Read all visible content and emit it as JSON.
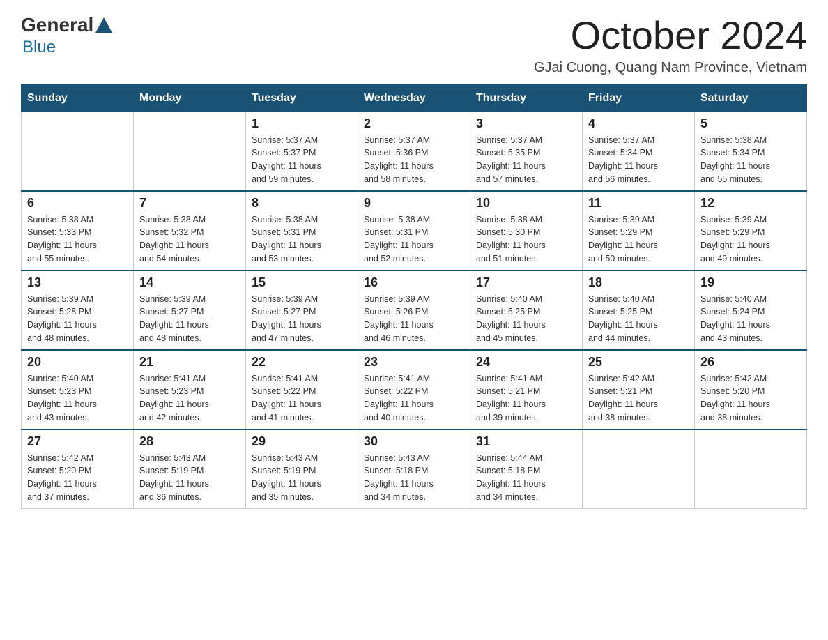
{
  "logo": {
    "general": "General",
    "blue": "Blue"
  },
  "title": "October 2024",
  "subtitle": "GJai Cuong, Quang Nam Province, Vietnam",
  "days_of_week": [
    "Sunday",
    "Monday",
    "Tuesday",
    "Wednesday",
    "Thursday",
    "Friday",
    "Saturday"
  ],
  "weeks": [
    [
      {
        "day": "",
        "info": ""
      },
      {
        "day": "",
        "info": ""
      },
      {
        "day": "1",
        "info": "Sunrise: 5:37 AM\nSunset: 5:37 PM\nDaylight: 11 hours\nand 59 minutes."
      },
      {
        "day": "2",
        "info": "Sunrise: 5:37 AM\nSunset: 5:36 PM\nDaylight: 11 hours\nand 58 minutes."
      },
      {
        "day": "3",
        "info": "Sunrise: 5:37 AM\nSunset: 5:35 PM\nDaylight: 11 hours\nand 57 minutes."
      },
      {
        "day": "4",
        "info": "Sunrise: 5:37 AM\nSunset: 5:34 PM\nDaylight: 11 hours\nand 56 minutes."
      },
      {
        "day": "5",
        "info": "Sunrise: 5:38 AM\nSunset: 5:34 PM\nDaylight: 11 hours\nand 55 minutes."
      }
    ],
    [
      {
        "day": "6",
        "info": "Sunrise: 5:38 AM\nSunset: 5:33 PM\nDaylight: 11 hours\nand 55 minutes."
      },
      {
        "day": "7",
        "info": "Sunrise: 5:38 AM\nSunset: 5:32 PM\nDaylight: 11 hours\nand 54 minutes."
      },
      {
        "day": "8",
        "info": "Sunrise: 5:38 AM\nSunset: 5:31 PM\nDaylight: 11 hours\nand 53 minutes."
      },
      {
        "day": "9",
        "info": "Sunrise: 5:38 AM\nSunset: 5:31 PM\nDaylight: 11 hours\nand 52 minutes."
      },
      {
        "day": "10",
        "info": "Sunrise: 5:38 AM\nSunset: 5:30 PM\nDaylight: 11 hours\nand 51 minutes."
      },
      {
        "day": "11",
        "info": "Sunrise: 5:39 AM\nSunset: 5:29 PM\nDaylight: 11 hours\nand 50 minutes."
      },
      {
        "day": "12",
        "info": "Sunrise: 5:39 AM\nSunset: 5:29 PM\nDaylight: 11 hours\nand 49 minutes."
      }
    ],
    [
      {
        "day": "13",
        "info": "Sunrise: 5:39 AM\nSunset: 5:28 PM\nDaylight: 11 hours\nand 48 minutes."
      },
      {
        "day": "14",
        "info": "Sunrise: 5:39 AM\nSunset: 5:27 PM\nDaylight: 11 hours\nand 48 minutes."
      },
      {
        "day": "15",
        "info": "Sunrise: 5:39 AM\nSunset: 5:27 PM\nDaylight: 11 hours\nand 47 minutes."
      },
      {
        "day": "16",
        "info": "Sunrise: 5:39 AM\nSunset: 5:26 PM\nDaylight: 11 hours\nand 46 minutes."
      },
      {
        "day": "17",
        "info": "Sunrise: 5:40 AM\nSunset: 5:25 PM\nDaylight: 11 hours\nand 45 minutes."
      },
      {
        "day": "18",
        "info": "Sunrise: 5:40 AM\nSunset: 5:25 PM\nDaylight: 11 hours\nand 44 minutes."
      },
      {
        "day": "19",
        "info": "Sunrise: 5:40 AM\nSunset: 5:24 PM\nDaylight: 11 hours\nand 43 minutes."
      }
    ],
    [
      {
        "day": "20",
        "info": "Sunrise: 5:40 AM\nSunset: 5:23 PM\nDaylight: 11 hours\nand 43 minutes."
      },
      {
        "day": "21",
        "info": "Sunrise: 5:41 AM\nSunset: 5:23 PM\nDaylight: 11 hours\nand 42 minutes."
      },
      {
        "day": "22",
        "info": "Sunrise: 5:41 AM\nSunset: 5:22 PM\nDaylight: 11 hours\nand 41 minutes."
      },
      {
        "day": "23",
        "info": "Sunrise: 5:41 AM\nSunset: 5:22 PM\nDaylight: 11 hours\nand 40 minutes."
      },
      {
        "day": "24",
        "info": "Sunrise: 5:41 AM\nSunset: 5:21 PM\nDaylight: 11 hours\nand 39 minutes."
      },
      {
        "day": "25",
        "info": "Sunrise: 5:42 AM\nSunset: 5:21 PM\nDaylight: 11 hours\nand 38 minutes."
      },
      {
        "day": "26",
        "info": "Sunrise: 5:42 AM\nSunset: 5:20 PM\nDaylight: 11 hours\nand 38 minutes."
      }
    ],
    [
      {
        "day": "27",
        "info": "Sunrise: 5:42 AM\nSunset: 5:20 PM\nDaylight: 11 hours\nand 37 minutes."
      },
      {
        "day": "28",
        "info": "Sunrise: 5:43 AM\nSunset: 5:19 PM\nDaylight: 11 hours\nand 36 minutes."
      },
      {
        "day": "29",
        "info": "Sunrise: 5:43 AM\nSunset: 5:19 PM\nDaylight: 11 hours\nand 35 minutes."
      },
      {
        "day": "30",
        "info": "Sunrise: 5:43 AM\nSunset: 5:18 PM\nDaylight: 11 hours\nand 34 minutes."
      },
      {
        "day": "31",
        "info": "Sunrise: 5:44 AM\nSunset: 5:18 PM\nDaylight: 11 hours\nand 34 minutes."
      },
      {
        "day": "",
        "info": ""
      },
      {
        "day": "",
        "info": ""
      }
    ]
  ]
}
